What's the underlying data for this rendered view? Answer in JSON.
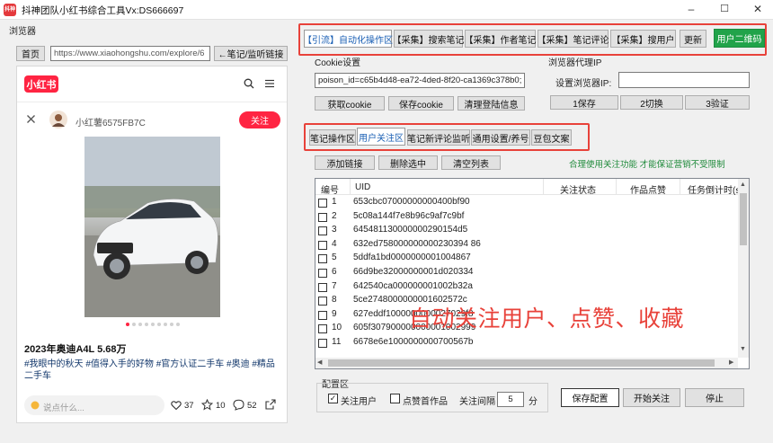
{
  "window": {
    "title": "抖神团队小红书综合工具Vx:DS666697",
    "icon_text": "抖神",
    "minimize": "–",
    "maximize": "☐",
    "close": "✕"
  },
  "browser": {
    "group_label": "浏览器",
    "home_button": "首页",
    "url": "https://www.xiaohongshu.com/explore/6",
    "watch_button": "←笔记/监听链接"
  },
  "xhs": {
    "logo": "小红书",
    "author_name": "小红薯6575FB7C",
    "follow_button": "关注",
    "post_title": "2023年奥迪A4L 5.68万",
    "tags": [
      "#我眼中的秋天",
      "#值得入手的好物",
      "#官方认证二手车",
      "#奥迪",
      "#精品二手车"
    ],
    "comment_placeholder": "说点什么...",
    "like_count": "37",
    "collect_count": "10",
    "comment_count": "52",
    "carousel_total": 9,
    "carousel_active": 1
  },
  "top_tabs": [
    {
      "label": "【引流】自动化操作区",
      "selected": true
    },
    {
      "label": "【采集】搜索笔记",
      "selected": false
    },
    {
      "label": "【采集】作者笔记",
      "selected": false
    },
    {
      "label": "【采集】笔记评论",
      "selected": false
    },
    {
      "label": "【采集】搜用户",
      "selected": false
    }
  ],
  "update_button": "更新",
  "qr_button": "用户二维码",
  "cookie": {
    "group_label": "Cookie设置",
    "value": "poison_id=c65b4d48-ea72-4ded-8f20-ca1369c378b0;",
    "get_button": "获取cookie",
    "save_button": "保存cookie",
    "clear_button": "清理登陆信息"
  },
  "proxy": {
    "group_label": "浏览器代理IP",
    "field_label": "设置浏览器IP:",
    "value": "",
    "btn1": "1保存",
    "btn2": "2切换",
    "btn3": "3验证"
  },
  "sub_tabs": [
    {
      "label": "笔记操作区",
      "selected": false
    },
    {
      "label": "用户关注区",
      "selected": true
    },
    {
      "label": "笔记新评论监听",
      "selected": false
    },
    {
      "label": "通用设置/养号",
      "selected": false
    },
    {
      "label": "豆包文案",
      "selected": false
    }
  ],
  "actions": {
    "add_link": "添加链接",
    "delete_selected": "删除选中",
    "clear_list": "清空列表",
    "hint": "合理使用关注功能 才能保证营销不受限制"
  },
  "table": {
    "columns": [
      "编号",
      "UID",
      "关注状态",
      "作品点赞",
      "任务倒计时(s)"
    ],
    "rows": [
      {
        "num": "1",
        "uid": "653cbc07000000000400bf90"
      },
      {
        "num": "2",
        "uid": "5c08a144f7e8b96c9af7c9bf"
      },
      {
        "num": "3",
        "uid": "645481130000000290154d5"
      },
      {
        "num": "4",
        "uid": "632ed758000000000230394 86"
      },
      {
        "num": "5",
        "uid": "5ddfa1bd0000000001004867"
      },
      {
        "num": "6",
        "uid": "66d9be32000000001d020334"
      },
      {
        "num": "7",
        "uid": "642540ca000000001002b32a"
      },
      {
        "num": "8",
        "uid": "5ce2748000000001602572c"
      },
      {
        "num": "9",
        "uid": "627eddf1000000000027029f8"
      },
      {
        "num": "10",
        "uid": "605f307900000000001002999"
      },
      {
        "num": "11",
        "uid": "6678e6e1000000000700567b"
      }
    ]
  },
  "overlay_text": "自动关注用户、点赞、收藏",
  "config": {
    "group_label": "配置区",
    "follow_user_label": "关注用户",
    "follow_user_checked": true,
    "like_work_label": "点赞首作品",
    "like_work_checked": false,
    "interval_label": "关注间隔",
    "interval_value": "5",
    "interval_unit": "分",
    "save_button": "保存配置",
    "start_button": "开始关注",
    "stop_button": "停止"
  },
  "colors": {
    "accent_red": "#e8423a",
    "xhs_red": "#ff2442",
    "qr_green": "#21a34a",
    "hint_green": "#1e8a3a",
    "overlay_text": "#e8423a",
    "tag_blue": "#13386c"
  }
}
